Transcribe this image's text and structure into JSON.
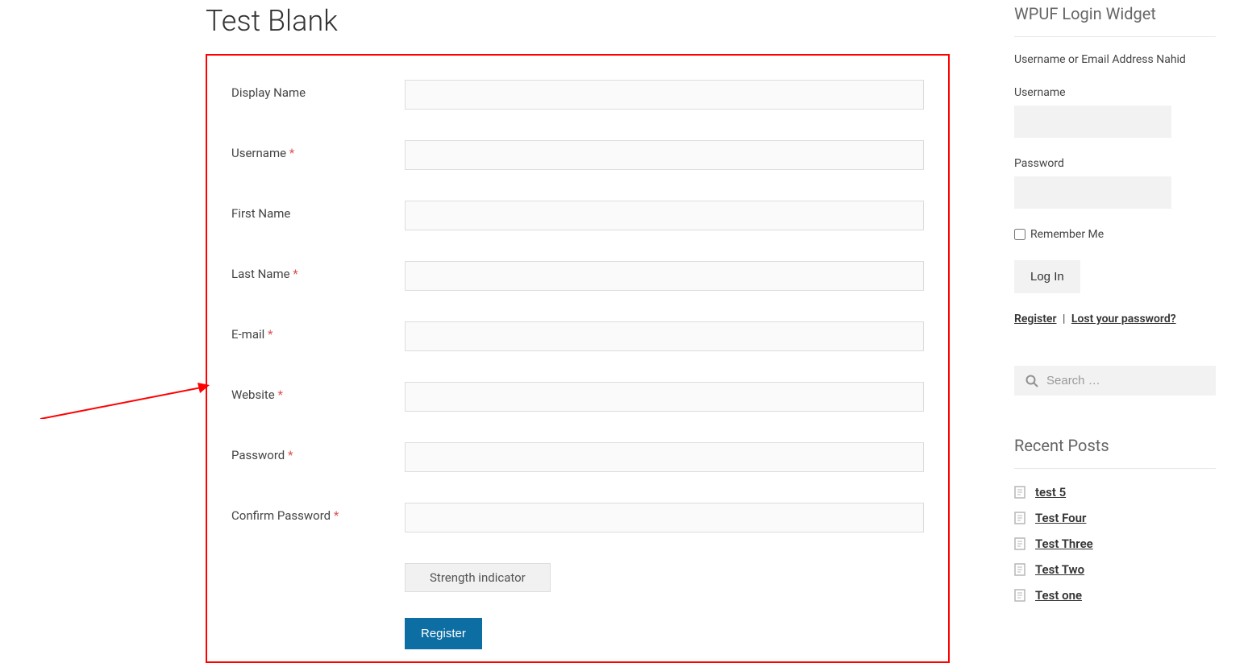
{
  "page": {
    "title": "Test Blank"
  },
  "form": {
    "fields": [
      {
        "label": "Display Name",
        "required": false,
        "type": "text"
      },
      {
        "label": "Username",
        "required": true,
        "type": "text"
      },
      {
        "label": "First Name",
        "required": false,
        "type": "text"
      },
      {
        "label": "Last Name",
        "required": true,
        "type": "text"
      },
      {
        "label": "E-mail",
        "required": true,
        "type": "text"
      },
      {
        "label": "Website",
        "required": true,
        "type": "text"
      },
      {
        "label": "Password",
        "required": true,
        "type": "password"
      },
      {
        "label": "Confirm Password",
        "required": true,
        "type": "password"
      }
    ],
    "strength_indicator": "Strength indicator",
    "submit_label": "Register"
  },
  "sidebar": {
    "login_widget": {
      "title": "WPUF Login Widget",
      "description": "Username or Email Address Nahid",
      "username_label": "Username",
      "password_label": "Password",
      "remember_label": "Remember Me",
      "login_button": "Log In",
      "register_link": "Register",
      "separator": "|",
      "lost_password_link": "Lost your password?"
    },
    "search": {
      "placeholder": "Search …"
    },
    "recent_posts": {
      "title": "Recent Posts",
      "items": [
        "test 5",
        "Test Four",
        "Test Three",
        "Test Two",
        "Test one"
      ]
    }
  },
  "annotation": {
    "arrow_color": "#ff0000",
    "box_color": "#ff0000"
  }
}
